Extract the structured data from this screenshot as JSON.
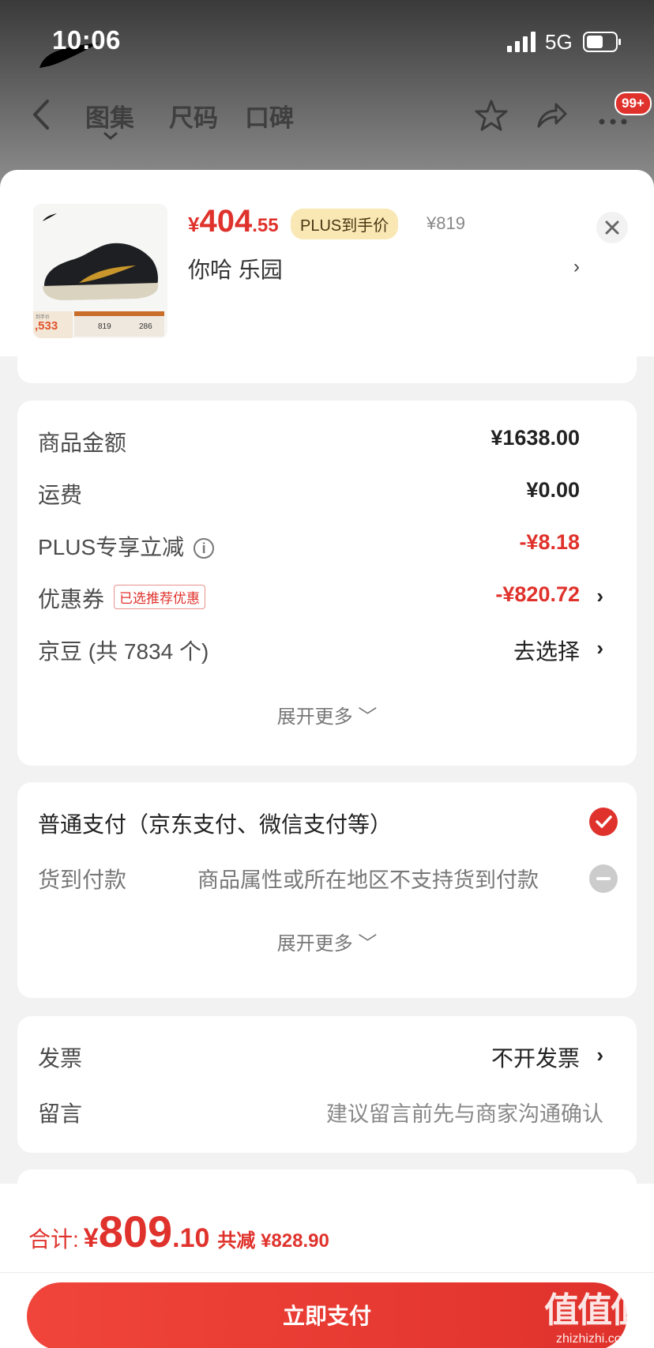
{
  "status_bar": {
    "time": "10:06",
    "network": "5G"
  },
  "nav": {
    "tabs": [
      "图集",
      "尺码",
      "口碑"
    ],
    "badge": "99+"
  },
  "product": {
    "price_symbol": "¥",
    "price_int": "404",
    "price_dec": ".55",
    "plus_tag": "PLUS到手价",
    "original_price": "¥819",
    "variant": "你哈  乐园",
    "variant_arrow": "›",
    "image_overlay": {
      "small_label": "到手价",
      "price": ",533",
      "box1_val": "819",
      "box2_val": "286"
    }
  },
  "amounts": {
    "rows": [
      {
        "label": "商品金额",
        "value": "¥1638.00"
      },
      {
        "label": "运费",
        "value": "¥0.00"
      },
      {
        "label": "PLUS专享立减",
        "value": "-¥8.18"
      },
      {
        "label": "优惠券",
        "tag": "已选推荐优惠",
        "value": "-¥820.72",
        "arrow": "›"
      },
      {
        "label": "京豆 (共 7834 个)",
        "value": "去选择",
        "arrow": "›"
      }
    ],
    "expand": "展开更多 ﹀"
  },
  "payment": {
    "normal": "普通支付（京东支付、微信支付等）",
    "cod_label": "货到付款",
    "cod_note": "商品属性或所在地区不支持货到付款",
    "expand": "展开更多 ﹀"
  },
  "invoice": {
    "label": "发票",
    "value": "不开发票",
    "arrow": "›",
    "message_label": "留言",
    "message_hint": "建议留言前先与商家沟通确认"
  },
  "footer": {
    "total_label": "合计:",
    "total_symbol": "¥",
    "total_int": "809",
    "total_dec": ".10",
    "discount": "共减 ¥828.90",
    "pay_button": "立即支付"
  },
  "watermark": {
    "big": "值值值",
    "small": "zhizhizhi.com"
  },
  "colors": {
    "accent": "#e0322c",
    "plus_tag_bg": "#f9e7b4"
  }
}
